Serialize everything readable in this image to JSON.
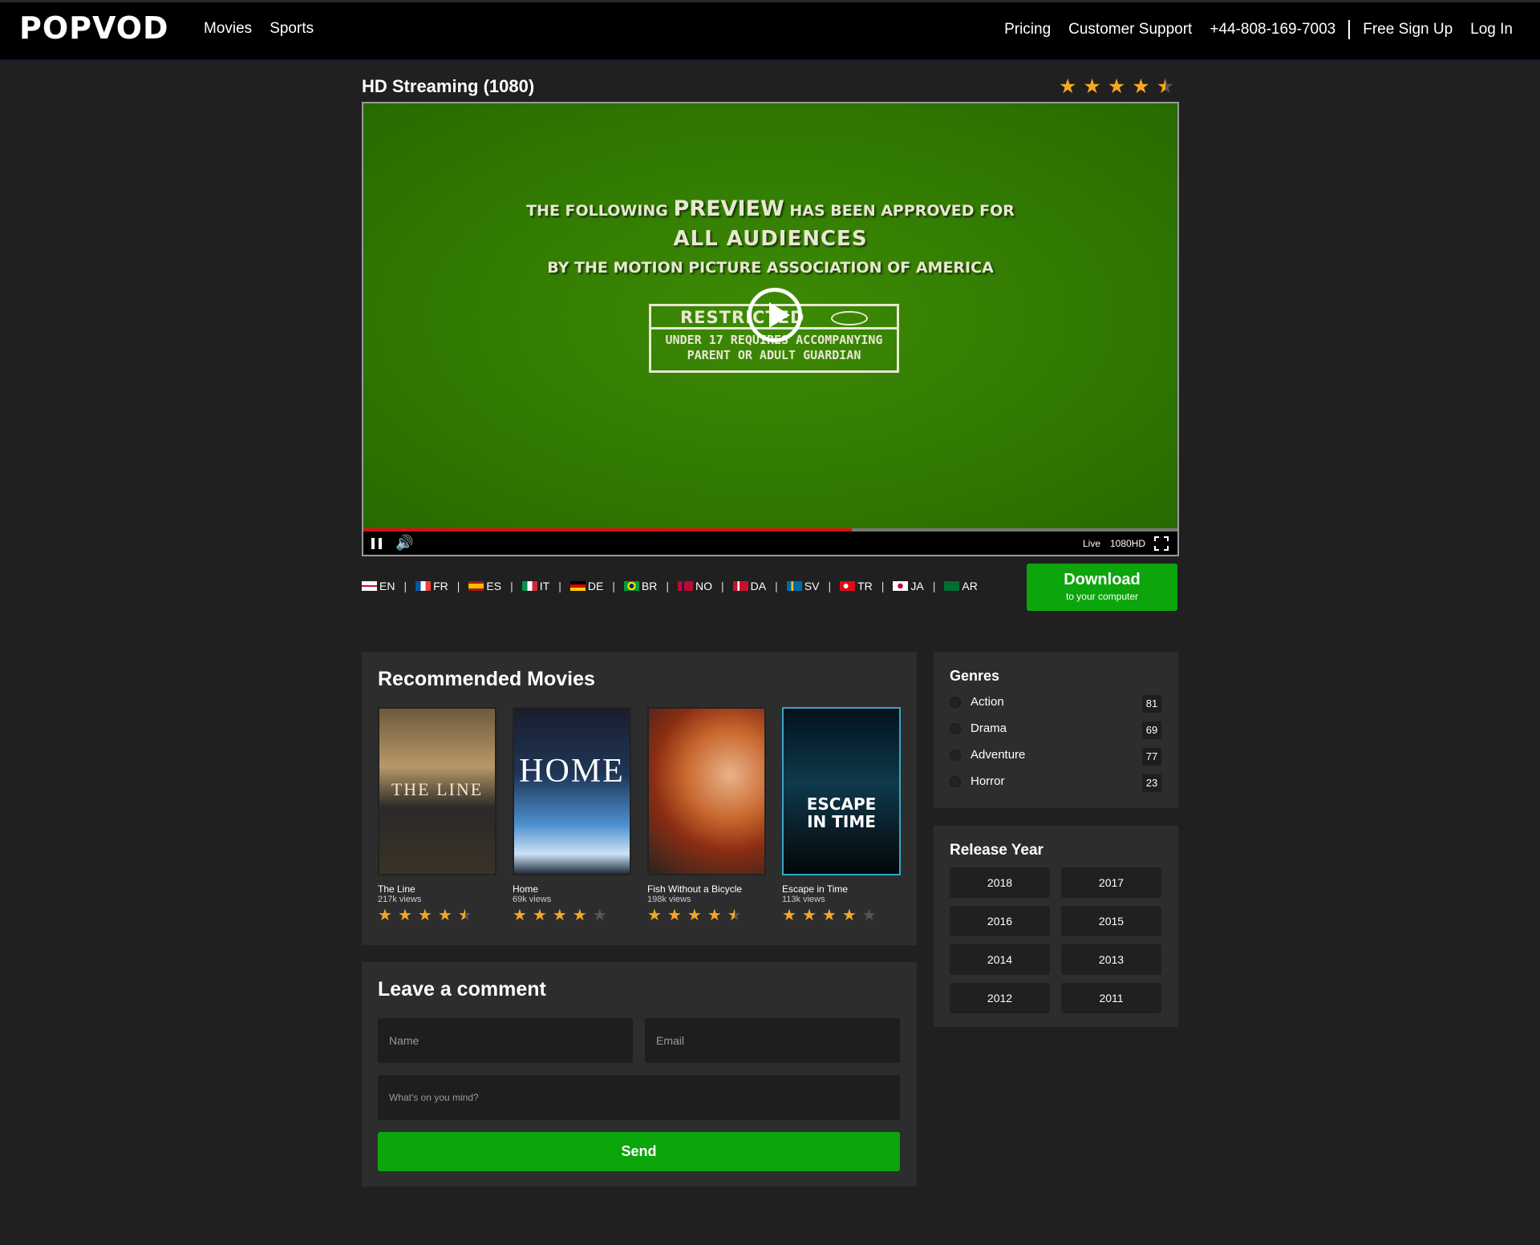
{
  "header": {
    "logo": "POPVOD",
    "nav_left": [
      "Movies",
      "Sports"
    ],
    "nav_right": {
      "pricing": "Pricing",
      "support": "Customer Support",
      "phone": "+44-808-169-7003",
      "signup": "Free Sign Up",
      "login": "Log In"
    }
  },
  "player": {
    "title": "HD Streaming (1080)",
    "rating_stars": 4.5,
    "screen": {
      "line1_a": "THE FOLLOWING",
      "line1_b": "PREVIEW",
      "line1_c": "HAS BEEN APPROVED FOR",
      "line2": "ALL AUDIENCES",
      "line3": "BY THE MOTION PICTURE ASSOCIATION OF AMERICA",
      "box_title": "RESTRICTED",
      "box_line1": "UNDER 17 REQUIRES ACCOMPANYING",
      "box_line2": "PARENT OR ADULT GUARDIAN"
    },
    "progress_percent": 60,
    "live_label": "Live",
    "quality_label": "1080HD"
  },
  "languages": [
    "EN",
    "FR",
    "ES",
    "IT",
    "DE",
    "BR",
    "NO",
    "DA",
    "SV",
    "TR",
    "JA",
    "AR"
  ],
  "download": {
    "label": "Download",
    "sub": "to your computer"
  },
  "recommended": {
    "title": "Recommended Movies",
    "movies": [
      {
        "name": "The Line",
        "views": "217k views",
        "stars": 4.5,
        "poster_text": "THE LINE"
      },
      {
        "name": "Home",
        "views": "69k views",
        "stars": 4,
        "poster_text": "HOME"
      },
      {
        "name": "Fish Without a Bicycle",
        "views": "198k views",
        "stars": 4.5,
        "poster_text": ""
      },
      {
        "name": "Escape in Time",
        "views": "113k views",
        "stars": 4,
        "poster_text": "ESCAPE IN TIME"
      }
    ]
  },
  "comment": {
    "title": "Leave a comment",
    "name_placeholder": "Name",
    "email_placeholder": "Email",
    "message_placeholder": "What's on you mind?",
    "send_label": "Send"
  },
  "genres": {
    "title": "Genres",
    "items": [
      {
        "label": "Action",
        "count": "81"
      },
      {
        "label": "Drama",
        "count": "69"
      },
      {
        "label": "Adventure",
        "count": "77"
      },
      {
        "label": "Horror",
        "count": "23"
      }
    ]
  },
  "release_year": {
    "title": "Release Year",
    "years": [
      "2018",
      "2017",
      "2016",
      "2015",
      "2014",
      "2013",
      "2012",
      "2011"
    ]
  },
  "colors": {
    "accent_green": "#0ca50c",
    "star": "#f5a623",
    "progress": "#d7101a"
  }
}
